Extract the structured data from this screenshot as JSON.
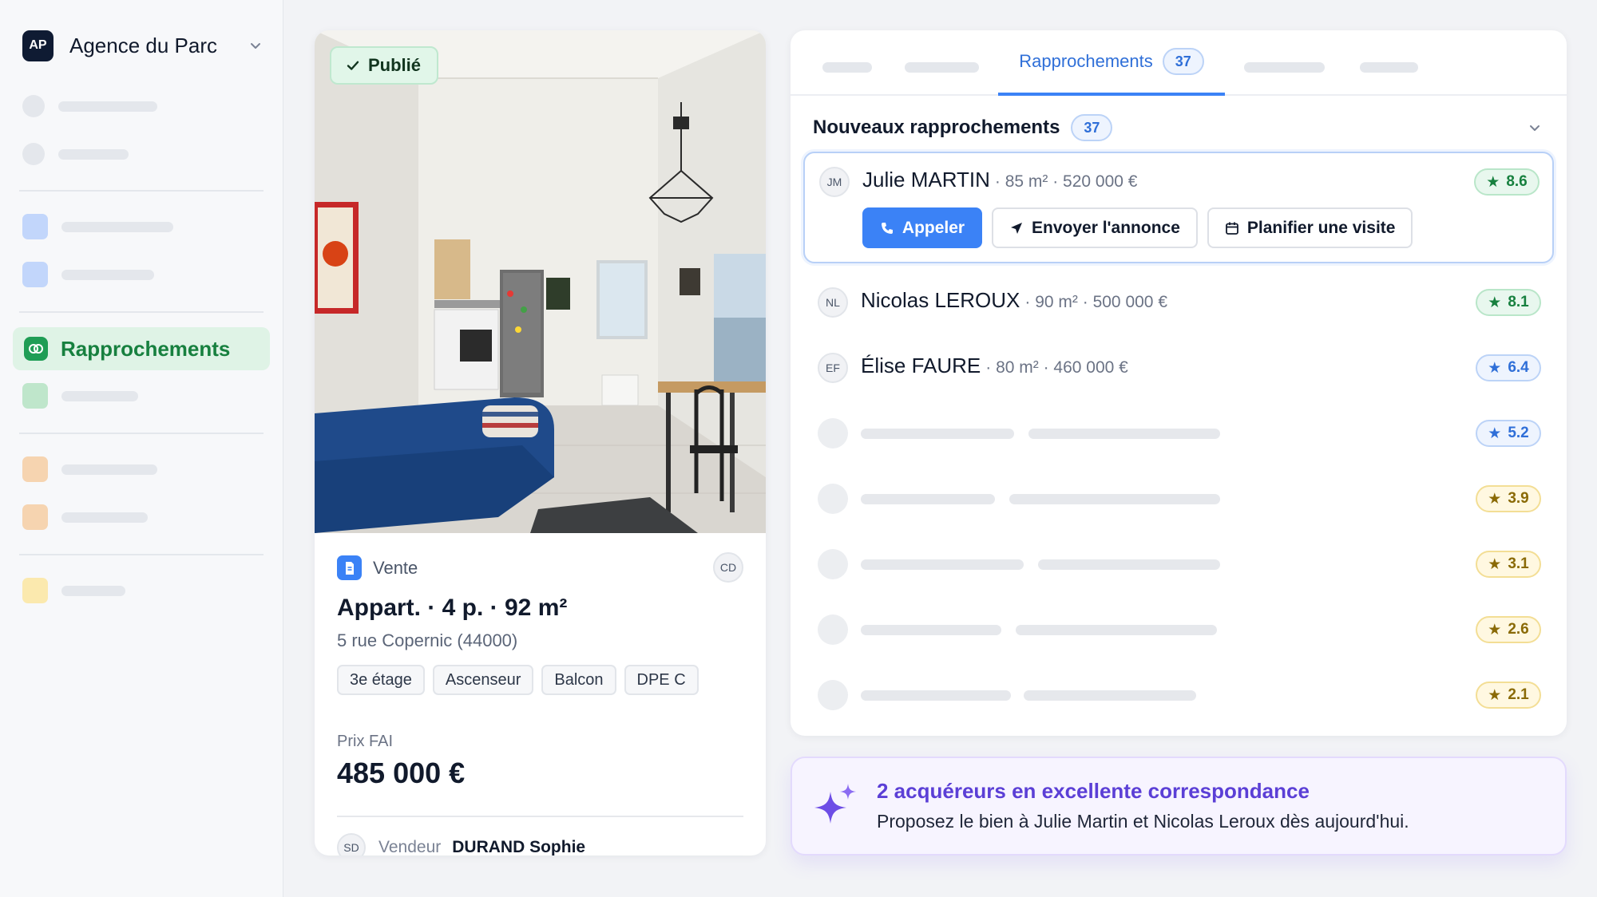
{
  "sidebar": {
    "org": {
      "initials": "AP",
      "name": "Agence du Parc",
      "chevron_icon": "chevron-down-icon"
    },
    "active_item": {
      "label": "Rapprochements",
      "icon": "link-icon",
      "color": "#1f9d55"
    }
  },
  "listing": {
    "status": {
      "label": "Publié",
      "icon": "check-icon"
    },
    "photo": {
      "icon": "apartment-photo"
    },
    "type": {
      "label": "Vente",
      "icon": "document-icon"
    },
    "agent_initials": "CD",
    "title": "Appart. · 4 p. · 92 m²",
    "address": "5 rue Copernic (44000)",
    "tags": [
      "3e étage",
      "Ascenseur",
      "Balcon",
      "DPE C"
    ],
    "price_label": "Prix FAI",
    "price_value": "485 000 €",
    "seller": {
      "initials": "SD",
      "label": "Vendeur",
      "name": "DURAND Sophie"
    }
  },
  "matches": {
    "active_tab": {
      "label": "Rapprochements",
      "count": "37"
    },
    "section": {
      "title": "Nouveaux rapprochements",
      "count": "37"
    },
    "rows": [
      {
        "initials": "JM",
        "name": "Julie MARTIN",
        "detail": "· 85 m² · 520 000 €",
        "score": "8.6"
      },
      {
        "initials": "NL",
        "name": "Nicolas LEROUX",
        "detail": "· 90 m² · 500 000 €",
        "score": "8.1"
      },
      {
        "initials": "EF",
        "name": "Élise FAURE",
        "detail": "· 80 m² · 460 000 €",
        "score": "6.4"
      }
    ],
    "placeholder_scores": [
      "5.2",
      "3.9",
      "3.1",
      "2.6",
      "2.1"
    ],
    "actions": {
      "call": "Appeler",
      "send": "Envoyer l'annonce",
      "schedule": "Planifier une visite"
    },
    "colors": {
      "accent": "#3b82f6",
      "good": "#17803f",
      "medium": "#2f6fd8",
      "low": "#8a6a06"
    }
  },
  "insight": {
    "icon": "sparkle-icon",
    "title": "2 acquéreurs en excellente correspondance",
    "text": "Proposez le bien à Julie Martin et Nicolas Leroux dès aujourd'hui."
  }
}
